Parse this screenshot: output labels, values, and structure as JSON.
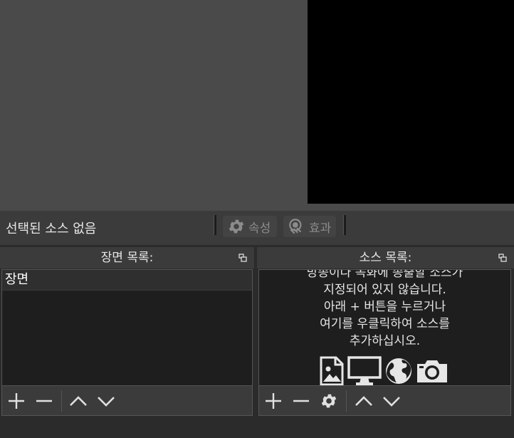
{
  "context_bar": {
    "no_source_label": "선택된 소스 없음",
    "properties_label": "속성",
    "filters_label": "효과"
  },
  "scenes_dock": {
    "title": "장면 목록:",
    "items": [
      {
        "label": "장면"
      }
    ]
  },
  "sources_dock": {
    "title": "소스 목록:",
    "help_lines": [
      "방송이나 녹화에 송출할 소스가",
      "지정되어 있지 않습니다.",
      "아래 + 버튼을 누르거나",
      "여기를 우클릭하여 소스를",
      "추가하십시오."
    ]
  },
  "colors": {
    "panel": "#3b3b3b",
    "list_bg": "#1e1e1e",
    "preview_bg": "#4a4a4a",
    "canvas": "#000000"
  }
}
